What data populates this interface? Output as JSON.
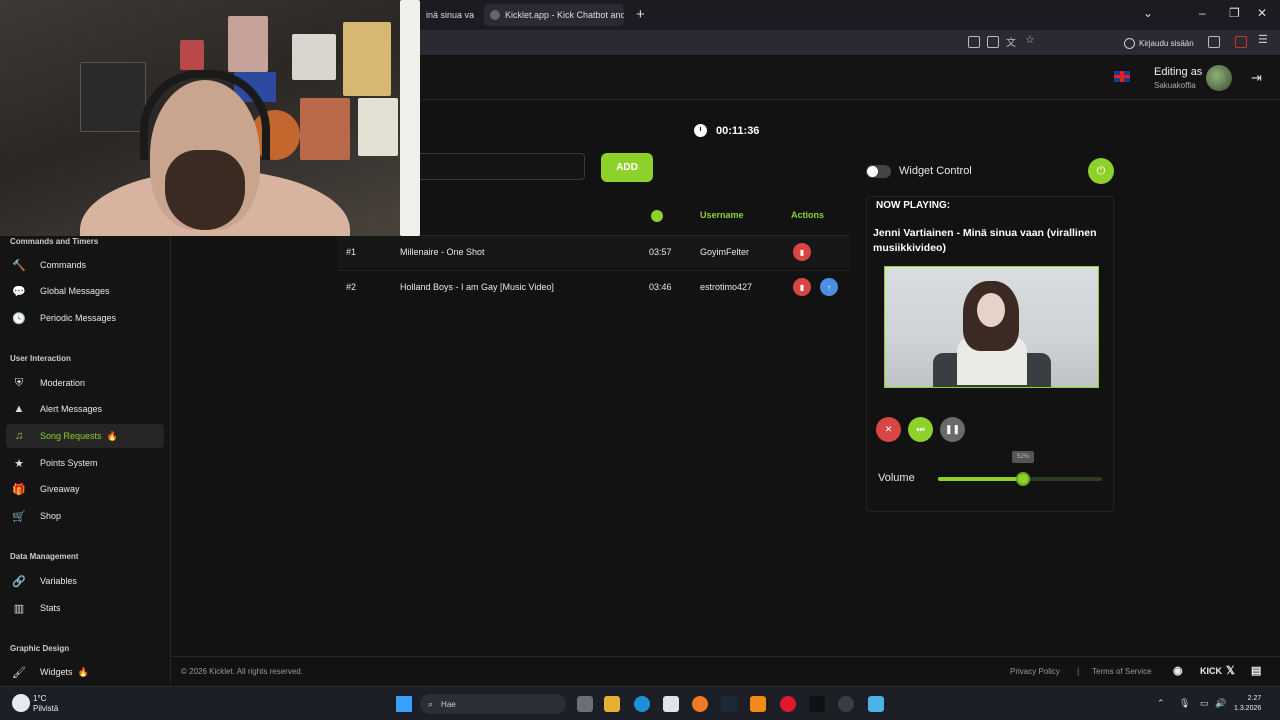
{
  "browser": {
    "tabs": [
      {
        "label": "inä sinua va"
      },
      {
        "label": "Kicklet.app - Kick Chatbot and C"
      }
    ],
    "login_label": "Kirjaudu sisään"
  },
  "header": {
    "editing_label": "Editing as",
    "username": "Sakuakoffia"
  },
  "sidebar": {
    "sections": [
      {
        "title": "Commands and Timers",
        "items": [
          "Commands",
          "Global Messages",
          "Periodic Messages"
        ]
      },
      {
        "title": "User Interaction",
        "items": [
          "Moderation",
          "Alert Messages",
          "Song Requests",
          "Points System",
          "Giveaway",
          "Shop"
        ]
      },
      {
        "title": "Data Management",
        "items": [
          "Variables",
          "Stats"
        ]
      },
      {
        "title": "Graphic Design",
        "items": [
          "Widgets"
        ]
      }
    ],
    "active_item": "Song Requests",
    "fire_badge": "🔥"
  },
  "main": {
    "timer": "00:11:36",
    "song_input_value": "",
    "add_label": "ADD",
    "columns": {
      "username": "Username",
      "actions": "Actions"
    },
    "queue": [
      {
        "pos": "#1",
        "title": "Millenaire - One Shot",
        "duration": "03:57",
        "username": "GoyimFelter"
      },
      {
        "pos": "#2",
        "title": "Holland Boys - I am Gay [Music Video]",
        "duration": "03:46",
        "username": "estrotimo427"
      }
    ]
  },
  "widget": {
    "control_label": "Widget Control",
    "control_enabled": false,
    "now_playing_label": "NOW PLAYING:",
    "now_playing_title": "Jenni Vartiainen - Minä sinua vaan (virallinen musiikkivideo)",
    "volume_label": "Volume",
    "volume_percent": 52,
    "volume_tooltip": "52%"
  },
  "footer": {
    "copyright": "© 2026 Kicklet. All rights reserved.",
    "privacy": "Privacy Policy",
    "separator": "|",
    "terms": "Terms of Service",
    "kick_label": "KICK"
  },
  "taskbar": {
    "temperature": "1°C",
    "weather": "Pilvistä",
    "search_placeholder": "Hae",
    "time": "2.27",
    "date": "1.3.2026"
  },
  "colors": {
    "accent": "#8ed12b",
    "danger": "#d84545",
    "info": "#4a8fe0",
    "background": "#121212"
  }
}
